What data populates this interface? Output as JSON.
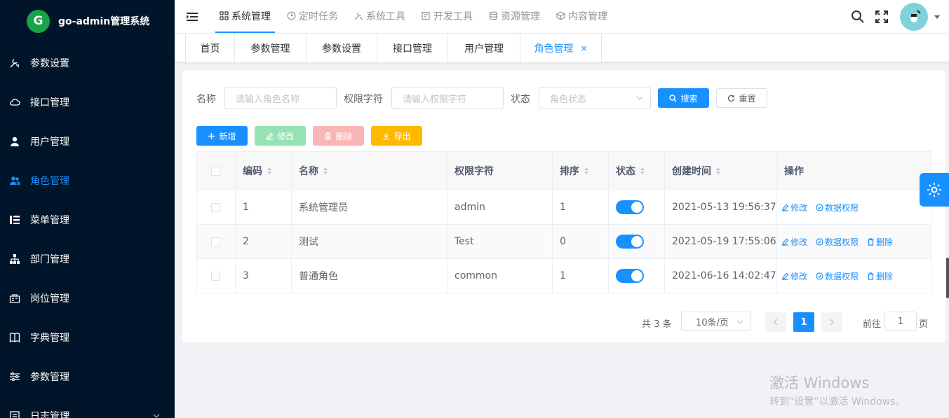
{
  "app": {
    "name": "go-admin管理系统",
    "logo_letter": "G"
  },
  "sidebar": {
    "items": [
      {
        "label": "参数设置",
        "icon": "tools-icon"
      },
      {
        "label": "接口管理",
        "icon": "cloud-icon"
      },
      {
        "label": "用户管理",
        "icon": "user-icon"
      },
      {
        "label": "角色管理",
        "icon": "users-icon",
        "active": true
      },
      {
        "label": "菜单管理",
        "icon": "tree-table-icon"
      },
      {
        "label": "部门管理",
        "icon": "org-tree-icon"
      },
      {
        "label": "岗位管理",
        "icon": "post-icon"
      },
      {
        "label": "字典管理",
        "icon": "book-icon"
      },
      {
        "label": "参数管理",
        "icon": "sliders-icon"
      },
      {
        "label": "日志管理",
        "icon": "log-icon"
      }
    ]
  },
  "topnav": {
    "items": [
      {
        "label": "系统管理",
        "active": true
      },
      {
        "label": "定时任务"
      },
      {
        "label": "系统工具"
      },
      {
        "label": "开发工具"
      },
      {
        "label": "资源管理"
      },
      {
        "label": "内容管理"
      }
    ]
  },
  "tags": {
    "items": [
      {
        "label": "首页"
      },
      {
        "label": "参数管理"
      },
      {
        "label": "参数设置"
      },
      {
        "label": "接口管理"
      },
      {
        "label": "用户管理"
      },
      {
        "label": "角色管理",
        "active": true,
        "close": "×"
      }
    ]
  },
  "search": {
    "name_label": "名称",
    "name_placeholder": "请输入角色名称",
    "key_label": "权限字符",
    "key_placeholder": "请输入权限字符",
    "status_label": "状态",
    "status_placeholder": "角色状态",
    "search_btn": "搜索",
    "reset_btn": "重置"
  },
  "toolbar": {
    "add": "新增",
    "edit": "修改",
    "delete": "删除",
    "export": "导出"
  },
  "table": {
    "columns": [
      "编码",
      "名称",
      "权限字符",
      "排序",
      "状态",
      "创建时间",
      "操作"
    ],
    "rows": [
      {
        "id": "1",
        "name": "系统管理员",
        "key": "admin",
        "sort": "1",
        "status": true,
        "created": "2021-05-13 19:56:37",
        "ops": [
          "修改",
          "数据权限"
        ]
      },
      {
        "id": "2",
        "name": "测试",
        "key": "Test",
        "sort": "0",
        "status": true,
        "created": "2021-05-19 17:55:06",
        "ops": [
          "修改",
          "数据权限",
          "删除"
        ]
      },
      {
        "id": "3",
        "name": "普通角色",
        "key": "common",
        "sort": "1",
        "status": true,
        "created": "2021-06-16 14:02:47",
        "ops": [
          "修改",
          "数据权限",
          "删除"
        ]
      }
    ]
  },
  "pagination": {
    "total": "共 3 条",
    "page_size": "10条/页",
    "current": "1",
    "goto_label": "前往",
    "goto_value": "1",
    "page_unit": "页"
  },
  "watermark": {
    "line1": "激活 Windows",
    "line2": "转到“设置”以激活 Windows。"
  },
  "colors": {
    "sidebar_bg": "#001529",
    "primary": "#1890ff",
    "success_light": "#95e3b5",
    "danger_light": "#fab6b6",
    "warning": "#ffba00"
  }
}
